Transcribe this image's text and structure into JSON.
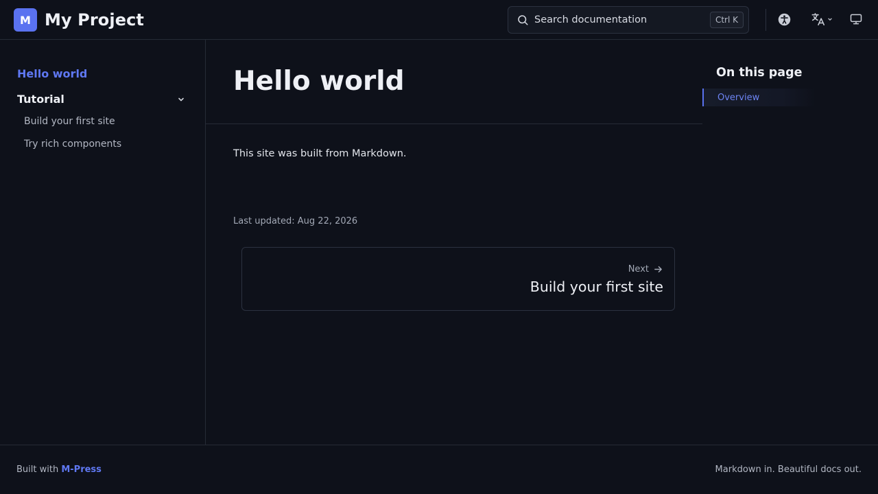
{
  "header": {
    "logo_letter": "M",
    "title": "My Project",
    "search": {
      "label": "Search documentation",
      "shortcut": "Ctrl K"
    },
    "icons": [
      "accessibility-icon",
      "language-icon",
      "chevron-down-icon",
      "theme-monitor-icon"
    ]
  },
  "sidebar": {
    "active_item": "Hello world",
    "group": {
      "label": "Tutorial",
      "expanded": true
    },
    "sub_items": [
      "Build your first site",
      "Try rich components"
    ]
  },
  "main": {
    "title": "Hello world",
    "body": "This site was built from Markdown.",
    "last_updated": "Last updated: Aug 22, 2026",
    "next": {
      "label": "Next",
      "title": "Build your first site"
    }
  },
  "toc": {
    "title": "On this page",
    "items": [
      "Overview"
    ]
  },
  "footer": {
    "built_with_prefix": "Built with ",
    "built_with_link": "M-Press",
    "tagline": "Markdown in. Beautiful docs out."
  },
  "colors": {
    "background": "#0e111a",
    "accent": "#5a72f0",
    "border": "#262b36"
  }
}
